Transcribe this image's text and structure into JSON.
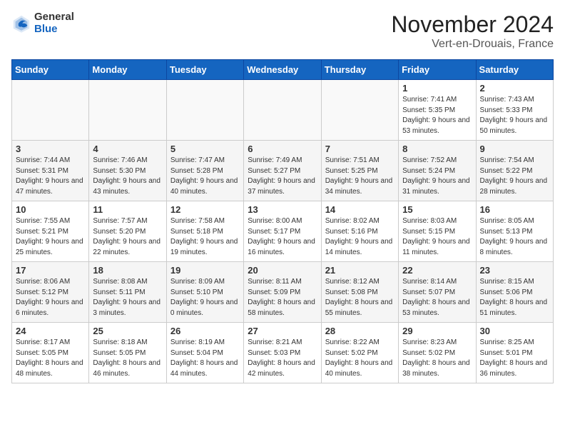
{
  "header": {
    "logo_general": "General",
    "logo_blue": "Blue",
    "month": "November 2024",
    "location": "Vert-en-Drouais, France"
  },
  "weekdays": [
    "Sunday",
    "Monday",
    "Tuesday",
    "Wednesday",
    "Thursday",
    "Friday",
    "Saturday"
  ],
  "weeks": [
    [
      {
        "day": "",
        "info": ""
      },
      {
        "day": "",
        "info": ""
      },
      {
        "day": "",
        "info": ""
      },
      {
        "day": "",
        "info": ""
      },
      {
        "day": "",
        "info": ""
      },
      {
        "day": "1",
        "info": "Sunrise: 7:41 AM\nSunset: 5:35 PM\nDaylight: 9 hours and 53 minutes."
      },
      {
        "day": "2",
        "info": "Sunrise: 7:43 AM\nSunset: 5:33 PM\nDaylight: 9 hours and 50 minutes."
      }
    ],
    [
      {
        "day": "3",
        "info": "Sunrise: 7:44 AM\nSunset: 5:31 PM\nDaylight: 9 hours and 47 minutes."
      },
      {
        "day": "4",
        "info": "Sunrise: 7:46 AM\nSunset: 5:30 PM\nDaylight: 9 hours and 43 minutes."
      },
      {
        "day": "5",
        "info": "Sunrise: 7:47 AM\nSunset: 5:28 PM\nDaylight: 9 hours and 40 minutes."
      },
      {
        "day": "6",
        "info": "Sunrise: 7:49 AM\nSunset: 5:27 PM\nDaylight: 9 hours and 37 minutes."
      },
      {
        "day": "7",
        "info": "Sunrise: 7:51 AM\nSunset: 5:25 PM\nDaylight: 9 hours and 34 minutes."
      },
      {
        "day": "8",
        "info": "Sunrise: 7:52 AM\nSunset: 5:24 PM\nDaylight: 9 hours and 31 minutes."
      },
      {
        "day": "9",
        "info": "Sunrise: 7:54 AM\nSunset: 5:22 PM\nDaylight: 9 hours and 28 minutes."
      }
    ],
    [
      {
        "day": "10",
        "info": "Sunrise: 7:55 AM\nSunset: 5:21 PM\nDaylight: 9 hours and 25 minutes."
      },
      {
        "day": "11",
        "info": "Sunrise: 7:57 AM\nSunset: 5:20 PM\nDaylight: 9 hours and 22 minutes."
      },
      {
        "day": "12",
        "info": "Sunrise: 7:58 AM\nSunset: 5:18 PM\nDaylight: 9 hours and 19 minutes."
      },
      {
        "day": "13",
        "info": "Sunrise: 8:00 AM\nSunset: 5:17 PM\nDaylight: 9 hours and 16 minutes."
      },
      {
        "day": "14",
        "info": "Sunrise: 8:02 AM\nSunset: 5:16 PM\nDaylight: 9 hours and 14 minutes."
      },
      {
        "day": "15",
        "info": "Sunrise: 8:03 AM\nSunset: 5:15 PM\nDaylight: 9 hours and 11 minutes."
      },
      {
        "day": "16",
        "info": "Sunrise: 8:05 AM\nSunset: 5:13 PM\nDaylight: 9 hours and 8 minutes."
      }
    ],
    [
      {
        "day": "17",
        "info": "Sunrise: 8:06 AM\nSunset: 5:12 PM\nDaylight: 9 hours and 6 minutes."
      },
      {
        "day": "18",
        "info": "Sunrise: 8:08 AM\nSunset: 5:11 PM\nDaylight: 9 hours and 3 minutes."
      },
      {
        "day": "19",
        "info": "Sunrise: 8:09 AM\nSunset: 5:10 PM\nDaylight: 9 hours and 0 minutes."
      },
      {
        "day": "20",
        "info": "Sunrise: 8:11 AM\nSunset: 5:09 PM\nDaylight: 8 hours and 58 minutes."
      },
      {
        "day": "21",
        "info": "Sunrise: 8:12 AM\nSunset: 5:08 PM\nDaylight: 8 hours and 55 minutes."
      },
      {
        "day": "22",
        "info": "Sunrise: 8:14 AM\nSunset: 5:07 PM\nDaylight: 8 hours and 53 minutes."
      },
      {
        "day": "23",
        "info": "Sunrise: 8:15 AM\nSunset: 5:06 PM\nDaylight: 8 hours and 51 minutes."
      }
    ],
    [
      {
        "day": "24",
        "info": "Sunrise: 8:17 AM\nSunset: 5:05 PM\nDaylight: 8 hours and 48 minutes."
      },
      {
        "day": "25",
        "info": "Sunrise: 8:18 AM\nSunset: 5:05 PM\nDaylight: 8 hours and 46 minutes."
      },
      {
        "day": "26",
        "info": "Sunrise: 8:19 AM\nSunset: 5:04 PM\nDaylight: 8 hours and 44 minutes."
      },
      {
        "day": "27",
        "info": "Sunrise: 8:21 AM\nSunset: 5:03 PM\nDaylight: 8 hours and 42 minutes."
      },
      {
        "day": "28",
        "info": "Sunrise: 8:22 AM\nSunset: 5:02 PM\nDaylight: 8 hours and 40 minutes."
      },
      {
        "day": "29",
        "info": "Sunrise: 8:23 AM\nSunset: 5:02 PM\nDaylight: 8 hours and 38 minutes."
      },
      {
        "day": "30",
        "info": "Sunrise: 8:25 AM\nSunset: 5:01 PM\nDaylight: 8 hours and 36 minutes."
      }
    ]
  ]
}
